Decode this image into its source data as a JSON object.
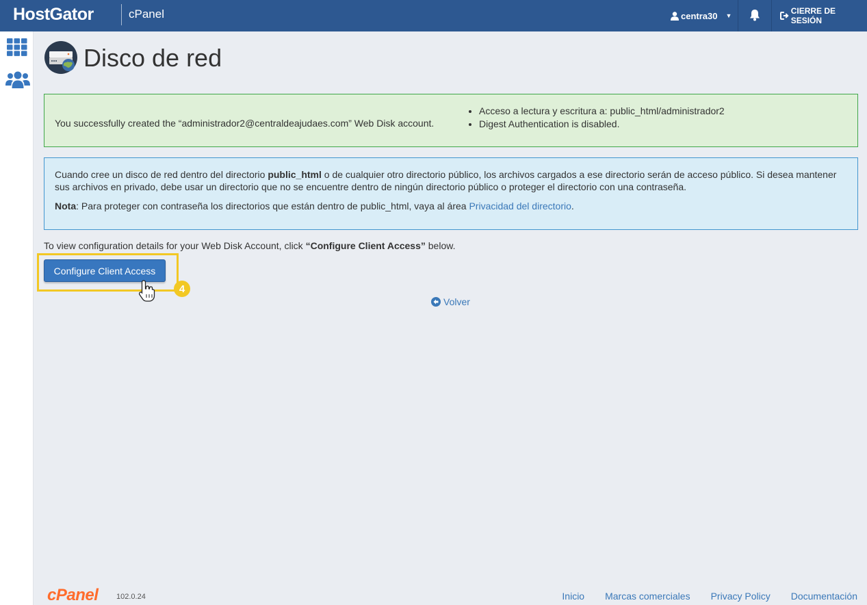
{
  "topbar": {
    "brand": "HostGator",
    "brand_sub": "cPanel",
    "username": "centra30",
    "logout_label": "CIERRE DE SESIÓN"
  },
  "page": {
    "title": "Disco de red"
  },
  "success_alert": {
    "message": "You successfully created the “administrador2@centraldeajudaes.com” Web Disk account.",
    "items": [
      "Acceso a lectura y escritura a: public_html/administrador2",
      "Digest Authentication is disabled."
    ]
  },
  "info_alert": {
    "p1_before": "Cuando cree un disco de red dentro del directorio ",
    "p1_bold": "public_html",
    "p1_after": " o de cualquier otro directorio público, los archivos cargados a ese directorio serán de acceso público. Si desea mantener sus archivos en privado, debe usar un directorio que no se encuentre dentro de ningún directorio público o proteger el directorio con una contraseña.",
    "note_label": "Nota",
    "note_text": ": Para proteger con contraseña los directorios que están dentro de public_html, vaya al área ",
    "note_link": "Privacidad del directorio",
    "note_end": "."
  },
  "config": {
    "text_before": "To view configuration details for your Web Disk Account, click ",
    "text_bold": "“Configure Client Access”",
    "text_after": " below.",
    "button_label": "Configure Client Access",
    "step_number": "4"
  },
  "back_label": "Volver",
  "footer": {
    "logo": "cPanel",
    "version": "102.0.24",
    "links": [
      "Inicio",
      "Marcas comerciales",
      "Privacy Policy",
      "Documentación"
    ]
  },
  "colors": {
    "topbar": "#2d5891",
    "accent_link": "#3a78b8",
    "highlight": "#f2c824",
    "cpanel_orange": "#ff6c2c"
  }
}
